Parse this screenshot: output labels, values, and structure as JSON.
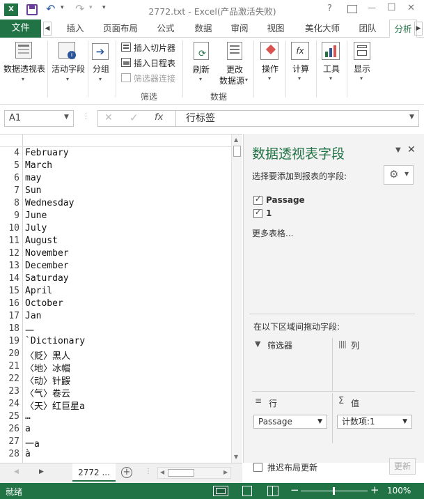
{
  "titlebar": {
    "title": "2772.txt - Excel(产品激活失败)",
    "help": "?",
    "minimize": "—",
    "restore": "☐",
    "close": "✕"
  },
  "tabs": {
    "file": "文件",
    "items": [
      "插入",
      "页面布局",
      "公式",
      "数据",
      "审阅",
      "视图",
      "美化大师",
      "团队",
      "分析"
    ]
  },
  "ribbon": {
    "pivot_name": "数据透视表",
    "active_field": "活动字段",
    "group": "分组",
    "insert_slicer": "插入切片器",
    "insert_timeline": "插入日程表",
    "filter_connections": "筛选器连接",
    "filter_group_label": "筛选",
    "refresh": "刷新",
    "change_source_line1": "更改",
    "change_source_line2": "数据源",
    "data_group_label": "数据",
    "actions": "操作",
    "calculations": "计算",
    "tools": "工具",
    "show": "显示"
  },
  "formula_bar": {
    "name_box": "A1",
    "fx": "fx",
    "value": "行标签"
  },
  "sheet": {
    "rows": [
      {
        "num": "4",
        "value": "February"
      },
      {
        "num": "5",
        "value": "March"
      },
      {
        "num": "6",
        "value": "may"
      },
      {
        "num": "7",
        "value": "Sun"
      },
      {
        "num": "8",
        "value": "Wednesday"
      },
      {
        "num": "9",
        "value": "June"
      },
      {
        "num": "10",
        "value": "July"
      },
      {
        "num": "11",
        "value": "August"
      },
      {
        "num": "12",
        "value": "November"
      },
      {
        "num": "13",
        "value": "December"
      },
      {
        "num": "14",
        "value": "Saturday"
      },
      {
        "num": "15",
        "value": "April"
      },
      {
        "num": "16",
        "value": "October"
      },
      {
        "num": "17",
        "value": "Jan"
      },
      {
        "num": "18",
        "value": "一"
      },
      {
        "num": "19",
        "value": "`Dictionary"
      },
      {
        "num": "20",
        "value": "〈贬〉黑人"
      },
      {
        "num": "21",
        "value": "〈地〉冰帽"
      },
      {
        "num": "22",
        "value": "〈动〉针鼹"
      },
      {
        "num": "23",
        "value": "〈气〉卷云"
      },
      {
        "num": "24",
        "value": "〈天〉红巨星a"
      },
      {
        "num": "25",
        "value": "…"
      },
      {
        "num": "26",
        "value": "a"
      },
      {
        "num": "27",
        "value": "一a"
      },
      {
        "num": "28",
        "value": "à"
      }
    ],
    "sheet_tab": "2772 ...",
    "add_sheet": "+"
  },
  "pivot_pane": {
    "title": "数据透视表字段",
    "subtitle": "选择要添加到报表的字段:",
    "fields": [
      {
        "label": "Passage",
        "checked": true
      },
      {
        "label": "1",
        "checked": true
      }
    ],
    "more_tables": "更多表格...",
    "drag_label": "在以下区域间拖动字段:",
    "filters_label": "筛选器",
    "columns_label": "列",
    "rows_label": "行",
    "values_label": "值",
    "rows_value": "Passage",
    "values_value": "计数项:1",
    "defer_label": "推迟布局更新",
    "update_button": "更新"
  },
  "status": {
    "ready": "就绪",
    "zoom": "100%"
  },
  "colors": {
    "excel_green": "#217346"
  }
}
